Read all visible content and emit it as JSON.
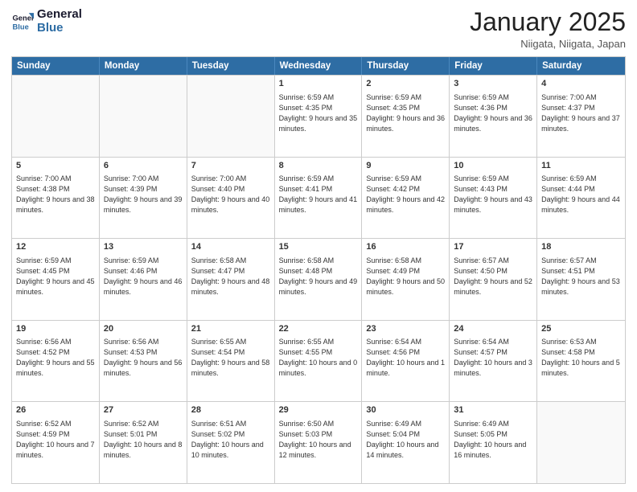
{
  "header": {
    "logo_line1": "General",
    "logo_line2": "Blue",
    "month": "January 2025",
    "location": "Niigata, Niigata, Japan"
  },
  "weekdays": [
    "Sunday",
    "Monday",
    "Tuesday",
    "Wednesday",
    "Thursday",
    "Friday",
    "Saturday"
  ],
  "weeks": [
    [
      {
        "day": "",
        "text": ""
      },
      {
        "day": "",
        "text": ""
      },
      {
        "day": "",
        "text": ""
      },
      {
        "day": "1",
        "text": "Sunrise: 6:59 AM\nSunset: 4:35 PM\nDaylight: 9 hours\nand 35 minutes."
      },
      {
        "day": "2",
        "text": "Sunrise: 6:59 AM\nSunset: 4:35 PM\nDaylight: 9 hours\nand 36 minutes."
      },
      {
        "day": "3",
        "text": "Sunrise: 6:59 AM\nSunset: 4:36 PM\nDaylight: 9 hours\nand 36 minutes."
      },
      {
        "day": "4",
        "text": "Sunrise: 7:00 AM\nSunset: 4:37 PM\nDaylight: 9 hours\nand 37 minutes."
      }
    ],
    [
      {
        "day": "5",
        "text": "Sunrise: 7:00 AM\nSunset: 4:38 PM\nDaylight: 9 hours\nand 38 minutes."
      },
      {
        "day": "6",
        "text": "Sunrise: 7:00 AM\nSunset: 4:39 PM\nDaylight: 9 hours\nand 39 minutes."
      },
      {
        "day": "7",
        "text": "Sunrise: 7:00 AM\nSunset: 4:40 PM\nDaylight: 9 hours\nand 40 minutes."
      },
      {
        "day": "8",
        "text": "Sunrise: 6:59 AM\nSunset: 4:41 PM\nDaylight: 9 hours\nand 41 minutes."
      },
      {
        "day": "9",
        "text": "Sunrise: 6:59 AM\nSunset: 4:42 PM\nDaylight: 9 hours\nand 42 minutes."
      },
      {
        "day": "10",
        "text": "Sunrise: 6:59 AM\nSunset: 4:43 PM\nDaylight: 9 hours\nand 43 minutes."
      },
      {
        "day": "11",
        "text": "Sunrise: 6:59 AM\nSunset: 4:44 PM\nDaylight: 9 hours\nand 44 minutes."
      }
    ],
    [
      {
        "day": "12",
        "text": "Sunrise: 6:59 AM\nSunset: 4:45 PM\nDaylight: 9 hours\nand 45 minutes."
      },
      {
        "day": "13",
        "text": "Sunrise: 6:59 AM\nSunset: 4:46 PM\nDaylight: 9 hours\nand 46 minutes."
      },
      {
        "day": "14",
        "text": "Sunrise: 6:58 AM\nSunset: 4:47 PM\nDaylight: 9 hours\nand 48 minutes."
      },
      {
        "day": "15",
        "text": "Sunrise: 6:58 AM\nSunset: 4:48 PM\nDaylight: 9 hours\nand 49 minutes."
      },
      {
        "day": "16",
        "text": "Sunrise: 6:58 AM\nSunset: 4:49 PM\nDaylight: 9 hours\nand 50 minutes."
      },
      {
        "day": "17",
        "text": "Sunrise: 6:57 AM\nSunset: 4:50 PM\nDaylight: 9 hours\nand 52 minutes."
      },
      {
        "day": "18",
        "text": "Sunrise: 6:57 AM\nSunset: 4:51 PM\nDaylight: 9 hours\nand 53 minutes."
      }
    ],
    [
      {
        "day": "19",
        "text": "Sunrise: 6:56 AM\nSunset: 4:52 PM\nDaylight: 9 hours\nand 55 minutes."
      },
      {
        "day": "20",
        "text": "Sunrise: 6:56 AM\nSunset: 4:53 PM\nDaylight: 9 hours\nand 56 minutes."
      },
      {
        "day": "21",
        "text": "Sunrise: 6:55 AM\nSunset: 4:54 PM\nDaylight: 9 hours\nand 58 minutes."
      },
      {
        "day": "22",
        "text": "Sunrise: 6:55 AM\nSunset: 4:55 PM\nDaylight: 10 hours\nand 0 minutes."
      },
      {
        "day": "23",
        "text": "Sunrise: 6:54 AM\nSunset: 4:56 PM\nDaylight: 10 hours\nand 1 minute."
      },
      {
        "day": "24",
        "text": "Sunrise: 6:54 AM\nSunset: 4:57 PM\nDaylight: 10 hours\nand 3 minutes."
      },
      {
        "day": "25",
        "text": "Sunrise: 6:53 AM\nSunset: 4:58 PM\nDaylight: 10 hours\nand 5 minutes."
      }
    ],
    [
      {
        "day": "26",
        "text": "Sunrise: 6:52 AM\nSunset: 4:59 PM\nDaylight: 10 hours\nand 7 minutes."
      },
      {
        "day": "27",
        "text": "Sunrise: 6:52 AM\nSunset: 5:01 PM\nDaylight: 10 hours\nand 8 minutes."
      },
      {
        "day": "28",
        "text": "Sunrise: 6:51 AM\nSunset: 5:02 PM\nDaylight: 10 hours\nand 10 minutes."
      },
      {
        "day": "29",
        "text": "Sunrise: 6:50 AM\nSunset: 5:03 PM\nDaylight: 10 hours\nand 12 minutes."
      },
      {
        "day": "30",
        "text": "Sunrise: 6:49 AM\nSunset: 5:04 PM\nDaylight: 10 hours\nand 14 minutes."
      },
      {
        "day": "31",
        "text": "Sunrise: 6:49 AM\nSunset: 5:05 PM\nDaylight: 10 hours\nand 16 minutes."
      },
      {
        "day": "",
        "text": ""
      }
    ]
  ]
}
